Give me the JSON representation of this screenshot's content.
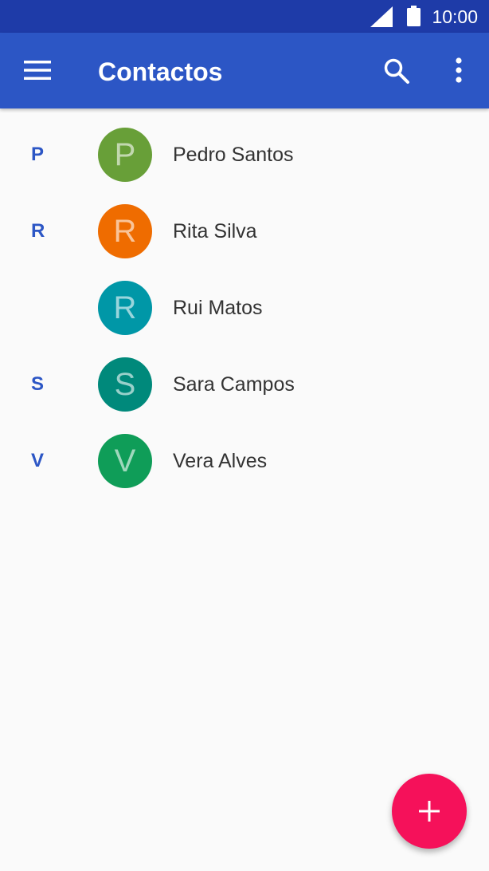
{
  "status_bar": {
    "time": "10:00",
    "signal_icon": "signal-icon",
    "battery_icon": "battery-icon"
  },
  "app_bar": {
    "title": "Contactos",
    "menu_icon": "menu-icon",
    "search_icon": "search-icon",
    "more_icon": "more-vert-icon"
  },
  "contacts": [
    {
      "section": "P",
      "initial": "P",
      "name": "Pedro Santos",
      "color": "#689f38"
    },
    {
      "section": "R",
      "initial": "R",
      "name": "Rita Silva",
      "color": "#ef6c00"
    },
    {
      "section": "",
      "initial": "R",
      "name": "Rui Matos",
      "color": "#0097a7"
    },
    {
      "section": "S",
      "initial": "S",
      "name": "Sara Campos",
      "color": "#00897b"
    },
    {
      "section": "V",
      "initial": "V",
      "name": "Vera Alves",
      "color": "#0f9d58"
    }
  ],
  "fab": {
    "icon": "add-icon",
    "color": "#f5115a"
  },
  "colors": {
    "status_bar": "#1e3ba8",
    "app_bar": "#2c56c5",
    "accent": "#2c56c5",
    "background": "#fafafa"
  }
}
